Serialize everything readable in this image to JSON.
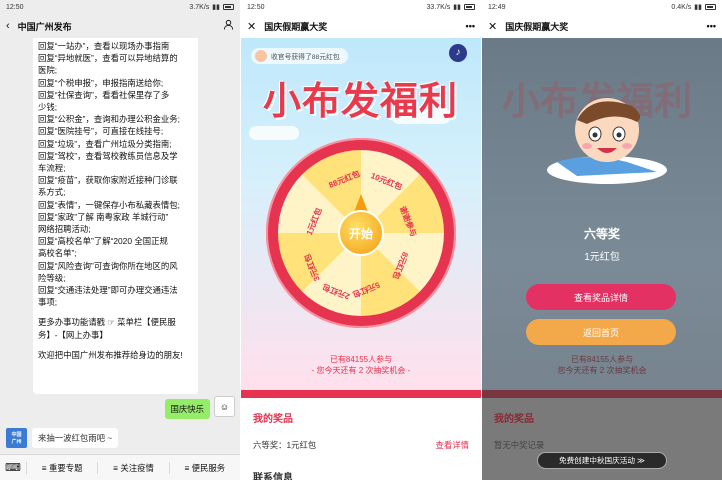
{
  "panel1": {
    "status_time": "12:50",
    "status_right": "3.7K/s",
    "title": "中国广州发布",
    "back_icon": "chevron-left-icon",
    "profile_icon": "person-icon",
    "message_lines": [
      "回复“一站办”，查看以现场办事指南",
      "回复“异地就医”，查看可以异地结算的",
      "医院;",
      "回复“个税申报”，申报指南送给你;",
      "回复“社保查询”，看看社保里存了多",
      "少钱;",
      "回复“公积金”，查询和办理公积金业务;",
      "回复“医院挂号”，可直接在线挂号;",
      "回复“垃圾”，查看广州垃圾分类指南;",
      "回复“驾校”，查看驾校教练员信息及学",
      "车流程;",
      "回复“疫苗”，获取你家附近接种门诊联",
      "系方式;",
      "回复“表情”，一键保存小布私藏表情包;",
      "回复“家政”了解 南粤家政 羊城行动”",
      "网络招聘活动;",
      "回复“高校名单”了解“2020 全国正规",
      "高校名单”;",
      "回复“风险查询”可查询你所在地区的风",
      "险等级;",
      "回复“交通违法处理”即可办理交通违法",
      "事项;"
    ],
    "more_text": "更多办事功能请戳 ☞ 菜单栏【便民服务】-【网上办事】",
    "recommend_text": "欢迎把中国广州发布推荐给身边的朋友!",
    "my_message": "国庆快乐",
    "card_text": "来抽一波红包雨吧 ~",
    "menus": [
      "≡ 重要专题",
      "≡ 关注疫情",
      "≡ 便民服务"
    ],
    "keyboard_icon": "keyboard-icon"
  },
  "panel2": {
    "status_time": "12:50",
    "status_right": "33.7K/s",
    "title": "国庆假期赢大奖",
    "notice": "收官号获得了88元红包",
    "big_title": "小布发福利",
    "wheel_segments": [
      "88元红包",
      "10元红包",
      "谢谢参与",
      "8元红包",
      "5元红包",
      "1元红包",
      "3元红包",
      "2元红包"
    ],
    "start_label": "开始",
    "participants_line1": "已有84155人参与",
    "participants_line2": "- 您今天还有 2 次抽奖机会 -",
    "my_prizes_title": "我的奖品",
    "prize_item": "六等奖：1元红包",
    "prize_link": "查看详情",
    "contact_title": "联系信息"
  },
  "panel3": {
    "status_time": "12:49",
    "status_right": "0.4K/s",
    "title": "国庆假期赢大奖",
    "big_title": "小布发福利",
    "award_level": "六等奖",
    "award_value": "1元红包",
    "view_button": "查看奖品详情",
    "home_button": "返回首页",
    "dim_participants": "已有84155人参与",
    "dim_chances": "您今天还有 2 次抽奖机会",
    "my_prizes_title": "我的奖品",
    "no_prize": "暂无中奖记录",
    "free_create": "免费创建中秋国庆活动 ≫"
  }
}
